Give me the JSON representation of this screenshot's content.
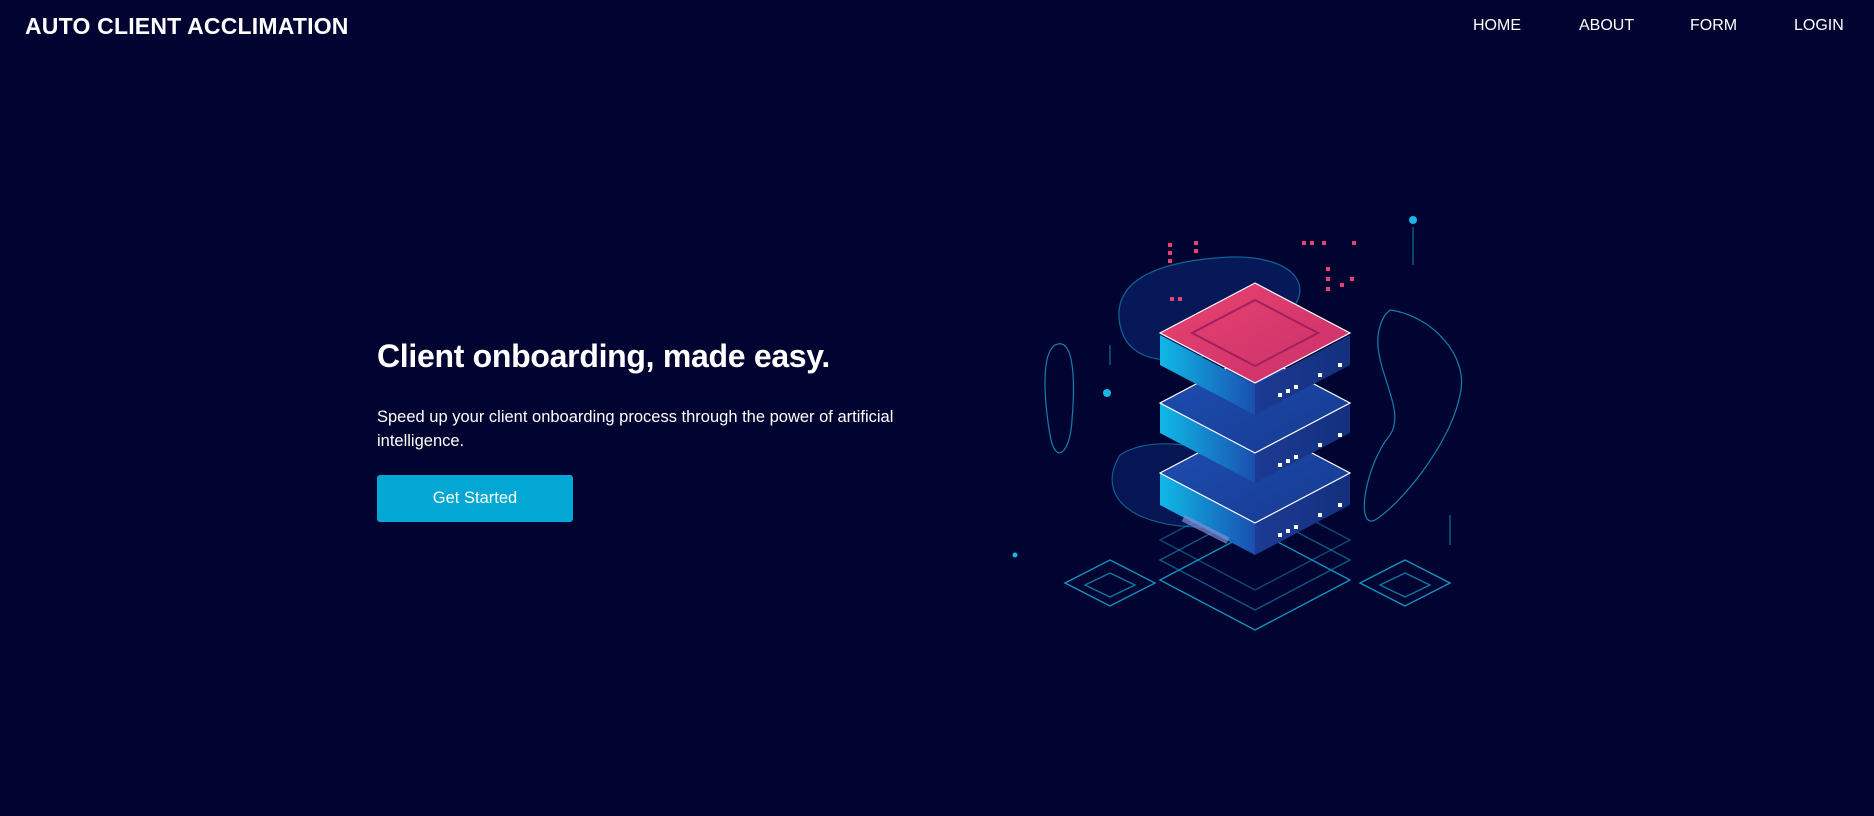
{
  "header": {
    "brand": "AUTO CLIENT ACCLIMATION",
    "nav": [
      "HOME",
      "ABOUT",
      "FORM",
      "LOGIN"
    ]
  },
  "hero": {
    "title": "Client onboarding, made easy.",
    "subtitle": "Speed up your client onboarding process through the power of artificial intelligence.",
    "cta_label": "Get Started"
  },
  "theme": {
    "background": "#010330",
    "accent": "#03a7d4",
    "highlight_pink": "#e8436f"
  },
  "illustration": {
    "icon": "server-stack-illustration"
  }
}
